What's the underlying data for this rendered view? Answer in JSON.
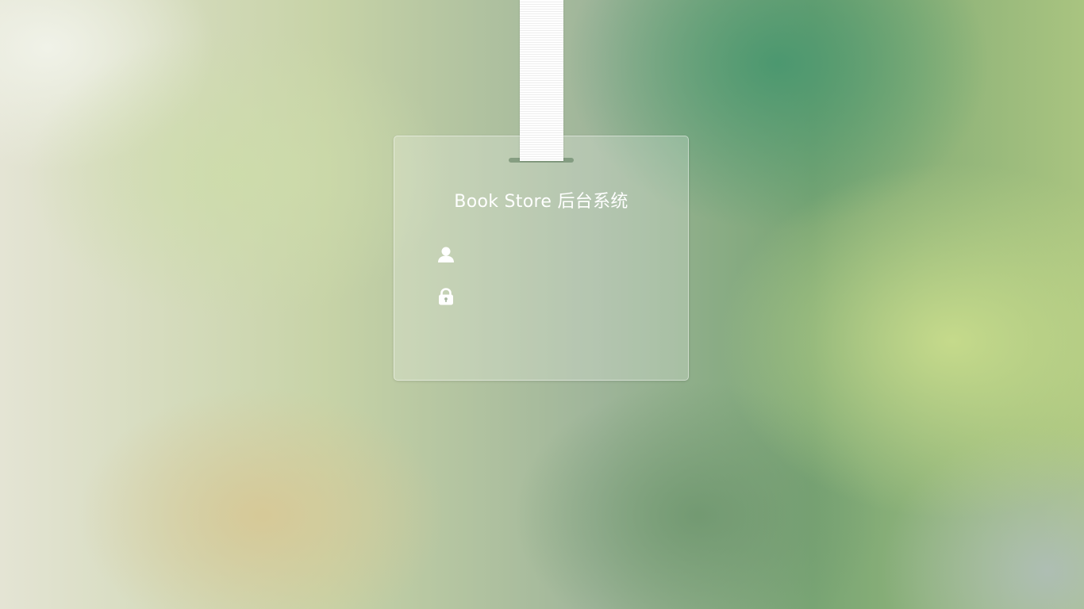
{
  "login": {
    "title": "Book Store 后台系统",
    "username": {
      "icon": "user-icon",
      "value": "",
      "placeholder": ""
    },
    "password": {
      "icon": "lock-icon",
      "value": "",
      "placeholder": ""
    }
  },
  "colors": {
    "text": "#ffffff",
    "card_bg": "rgba(255,255,255,0.22)",
    "strap": "#ffffff"
  }
}
